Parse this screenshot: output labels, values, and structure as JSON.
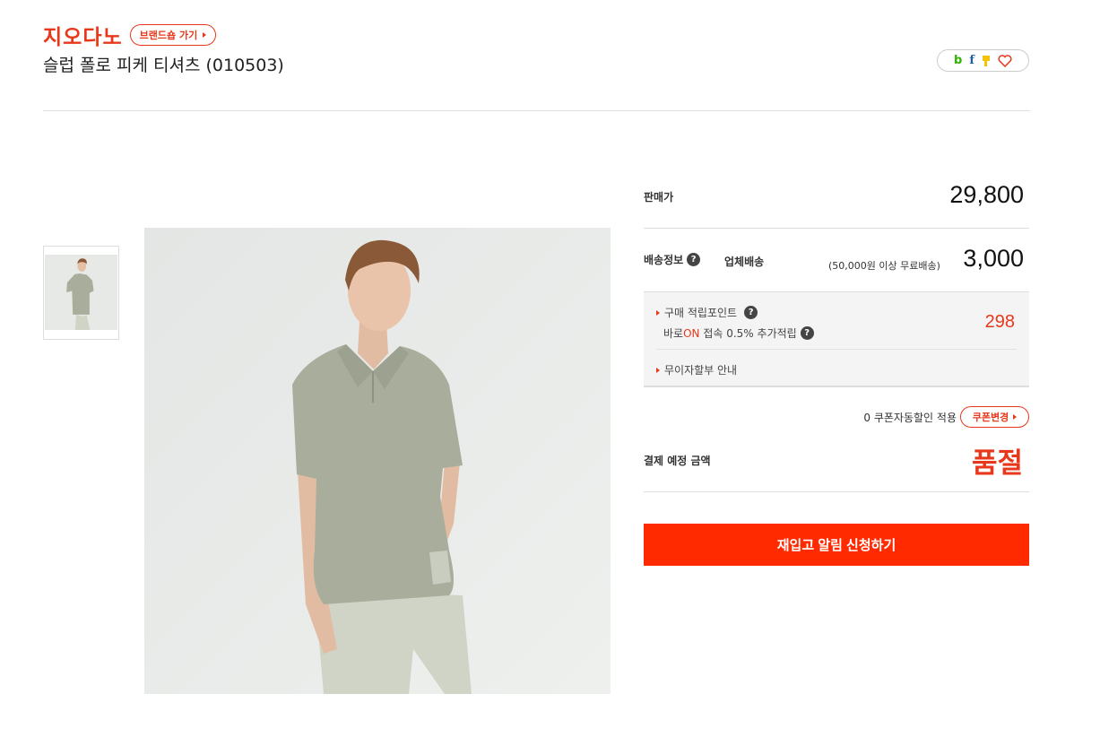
{
  "brand": {
    "name": "지오다노",
    "shop_button": "브랜드숍 가기"
  },
  "product": {
    "title": "슬럽 폴로 피케 티셔츠 (010503)"
  },
  "share": {
    "icons": [
      "blog-b-icon",
      "facebook-icon",
      "kakao-icon",
      "heart-icon"
    ],
    "blog_letter": "b",
    "facebook_letter": "f"
  },
  "price": {
    "label": "판매가",
    "value": "29,800"
  },
  "shipping": {
    "label": "배송정보",
    "type": "업체배송",
    "note": "(50,000원 이상 무료배송)",
    "value": "3,000"
  },
  "points": {
    "label": "구매 적립포인트",
    "value": "298",
    "baro_prefix": "바로",
    "baro_on": "ON",
    "baro_rest": " 접속 0.5% 추가적립",
    "installment": "무이자할부 안내"
  },
  "coupon": {
    "text": "0 쿠폰자동할인 적용",
    "button": "쿠폰변경"
  },
  "payment": {
    "label": "결제 예정 금액",
    "status": "품절"
  },
  "restock_button": "재입고 알림 신청하기",
  "colors": {
    "accent": "#e8381c",
    "cta": "#ff2a00",
    "shirt": "#a9ad9c",
    "pants": "#cfd4c6"
  }
}
